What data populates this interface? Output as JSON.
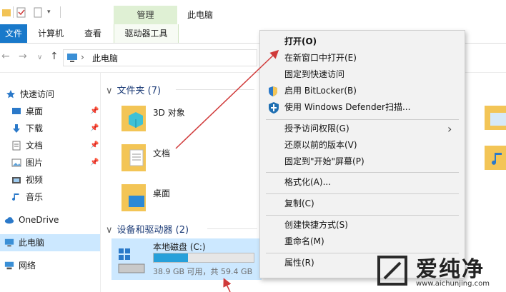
{
  "ribbon": {
    "tabs": [
      "文件",
      "计算机",
      "查看",
      "驱动器工具"
    ],
    "context_group": "管理",
    "window_title": "此电脑"
  },
  "address": {
    "location": "此电脑",
    "back_arrow": "←",
    "forward_arrow": "→",
    "chevron": "∨",
    "up_arrow": "↑",
    "separator": "›"
  },
  "nav": {
    "quick_access": "快速访问",
    "items": [
      {
        "label": "桌面",
        "pinned": true
      },
      {
        "label": "下载",
        "pinned": true
      },
      {
        "label": "文档",
        "pinned": true
      },
      {
        "label": "图片",
        "pinned": true
      },
      {
        "label": "视频",
        "pinned": false
      },
      {
        "label": "音乐",
        "pinned": false
      }
    ],
    "onedrive": "OneDrive",
    "this_pc": "此电脑",
    "network": "网络",
    "pin_glyph": "📌"
  },
  "content": {
    "folders_header": "文件夹 (7)",
    "folders": [
      "3D 对象",
      "文档",
      "桌面"
    ],
    "devices_header": "设备和驱动器 (2)",
    "drive": {
      "name": "本地磁盘 (C:)",
      "free_text": "38.9 GB 可用，共 59.4 GB",
      "used_fraction": 0.345
    }
  },
  "context_menu": {
    "items": [
      {
        "label": "打开(O)",
        "bold": true
      },
      {
        "label": "在新窗口中打开(E)"
      },
      {
        "label": "固定到快速访问"
      },
      {
        "label": "启用 BitLocker(B)",
        "icon": "shield-icon"
      },
      {
        "label": "使用 Windows Defender扫描...",
        "icon": "defender-icon"
      },
      {
        "label": "授予访问权限(G)",
        "submenu": true
      },
      {
        "label": "还原以前的版本(V)"
      },
      {
        "label": "固定到\"开始\"屏幕(P)"
      },
      {
        "label": "格式化(A)..."
      },
      {
        "label": "复制(C)"
      },
      {
        "label": "创建快捷方式(S)"
      },
      {
        "label": "重命名(M)"
      },
      {
        "label": "属性(R)"
      }
    ],
    "submenu_arrow": "›"
  },
  "watermark": {
    "brand": "爱纯净",
    "url": "www.aichunjing.com"
  },
  "colors": {
    "accent": "#1979ca",
    "context_tab": "#dff0d4",
    "selection": "#cce8ff",
    "arrow": "#d03a3a"
  }
}
